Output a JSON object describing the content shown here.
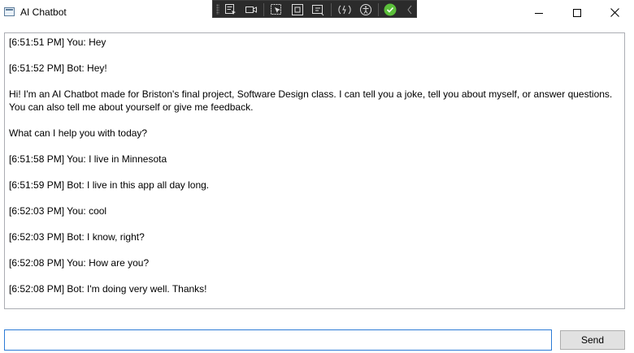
{
  "window": {
    "title": "AI Chatbot",
    "icons": {
      "app": "window-app-icon",
      "minimize": "minimize-icon",
      "maximize": "maximize-icon",
      "close": "close-icon"
    }
  },
  "debug_toolbar": {
    "icons": [
      "select-element-icon",
      "live-tree-icon",
      "select-element-cursor-icon",
      "adorner-icon",
      "layout-adjust-icon",
      "hot-reload-icon",
      "accessibility-icon",
      "ok-check-icon",
      "collapse-chevron-icon"
    ],
    "accent_color": "#5bbf3a"
  },
  "chat": {
    "messages": [
      "[6:51:51 PM] You: Hey",
      "[6:51:52 PM] Bot: Hey!",
      "Hi! I'm an AI Chatbot made for Briston's final project, Software Design class. I can tell you a joke, tell you about myself, or answer questions. You can also tell me about yourself or give me feedback.",
      "What can I help you with today?",
      "[6:51:58 PM] You: I live in Minnesota",
      "[6:51:59 PM] Bot: I live in this app all day long.",
      "[6:52:03 PM] You: cool",
      "[6:52:03 PM] Bot: I know, right?",
      "[6:52:08 PM] You: How are you?",
      "[6:52:08 PM] Bot: I'm doing very well. Thanks!"
    ]
  },
  "input": {
    "value": "",
    "placeholder": ""
  },
  "send": {
    "label": "Send"
  }
}
